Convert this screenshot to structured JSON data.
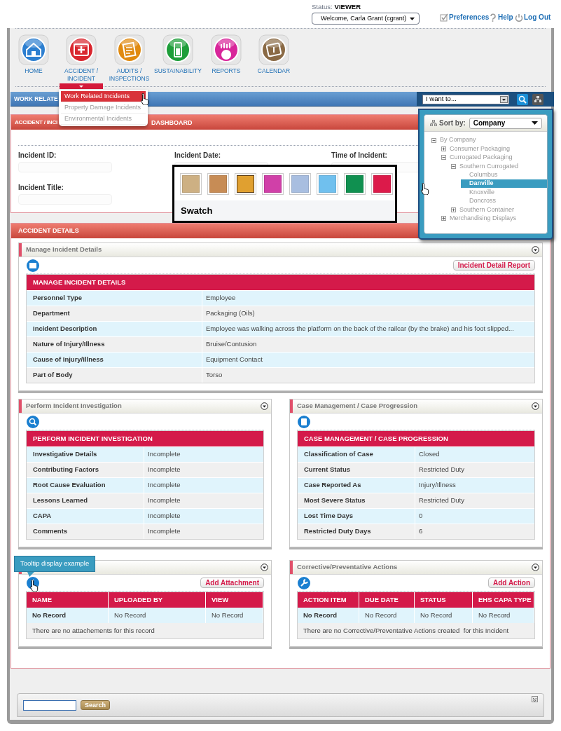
{
  "header": {
    "status_label": "Status:",
    "status_value": "VIEWER",
    "user_select": "Welcome, Carla Grant (cgrant)",
    "links": [
      "Preferences",
      "Help",
      "Log Out"
    ]
  },
  "nav": [
    {
      "label": "HOME",
      "color": "#2d7fd0",
      "selected": false
    },
    {
      "label": "ACCIDENT / INCIDENT",
      "color": "#d9262e",
      "selected": true
    },
    {
      "label": "AUDITS / INSPECTIONS",
      "color": "#e08a10",
      "selected": false
    },
    {
      "label": "SUSTAINABILITY",
      "color": "#1e9e3a",
      "selected": false
    },
    {
      "label": "REPORTS",
      "color": "#d8259a",
      "selected": false
    },
    {
      "label": "CALENDAR",
      "color": "#8a6a45",
      "selected": false
    }
  ],
  "menu": [
    {
      "label": "Work Related Incidents",
      "selected": true
    },
    {
      "label": "Property Damage Incidents",
      "selected": false
    },
    {
      "label": "Environmental Incidents",
      "selected": false
    }
  ],
  "bar": {
    "title": "WORK RELATE",
    "action_select": "I want to..."
  },
  "tree_popup": {
    "sort_label": "Sort by:",
    "sort_value": "Company",
    "tree": [
      {
        "label": "By Company",
        "expanded": true,
        "selected": false,
        "children": [
          {
            "label": "Consumer Packaging",
            "expanded": false,
            "selected": false
          },
          {
            "label": "Currogated Packaging",
            "expanded": true,
            "selected": false,
            "children": [
              {
                "label": "Southern Currogated",
                "expanded": true,
                "selected": false,
                "children": [
                  {
                    "label": "Columbus",
                    "selected": false
                  },
                  {
                    "label": "Danville",
                    "selected": true
                  },
                  {
                    "label": "Knoxville",
                    "selected": false
                  },
                  {
                    "label": "Doncross",
                    "selected": false
                  }
                ]
              },
              {
                "label": "Southern Container",
                "expanded": false,
                "selected": false
              }
            ]
          },
          {
            "label": "Merchandising Displays",
            "expanded": false,
            "selected": false
          }
        ]
      }
    ]
  },
  "dashboard_bar": {
    "title_left": "ACCIDENT / INCI",
    "title_right": "DASHBOARD"
  },
  "form": {
    "fields": [
      "Incident ID:",
      "Incident Date:",
      "Time of Incident:",
      "Incident Title:"
    ]
  },
  "swatch": {
    "title": "Swatch",
    "colors": [
      {
        "color": "#cdb083",
        "selected": false
      },
      {
        "color": "#c78c55",
        "selected": false
      },
      {
        "color": "#e0a030",
        "selected": true
      },
      {
        "color": "#d040a8",
        "selected": false
      },
      {
        "color": "#a8bee0",
        "selected": false
      },
      {
        "color": "#70c0ee",
        "selected": false
      },
      {
        "color": "#109050",
        "selected": false
      },
      {
        "color": "#dc1a4a",
        "selected": false
      }
    ]
  },
  "section_bar": "ACCIDENT DETAILS",
  "panels": [
    {
      "kind": "details",
      "title": "Manage Incident Details",
      "button": "Incident Detail Report",
      "table_title": "MANAGE INCIDENT DETAILS",
      "rows": [
        {
          "label": "Personnel Type",
          "value": "Employee"
        },
        {
          "label": "Department",
          "value": "Packaging (Oils)"
        },
        {
          "label": "Incident Description",
          "value": "Employee was walking across the platform on the back of the railcar (by the brake) and his foot slipped..."
        },
        {
          "label": "Nature of Injury/Illness",
          "value": "Bruise/Contusion"
        },
        {
          "label": "Cause of Injury/Illness",
          "value": "Equipment Contact"
        },
        {
          "label": "Part of Body",
          "value": "Torso"
        }
      ]
    },
    {
      "kind": "details",
      "title": "Perform Incident Investigation",
      "table_title": "PERFORM INCIDENT INVESTIGATION",
      "rows": [
        {
          "label": "Investigative Details",
          "value": "Incomplete"
        },
        {
          "label": "Contributing Factors",
          "value": "Incomplete"
        },
        {
          "label": "Root Cause Evaluation",
          "value": "Incomplete"
        },
        {
          "label": "Lessons Learned",
          "value": "Incomplete"
        },
        {
          "label": "CAPA",
          "value": "Incomplete"
        },
        {
          "label": "Comments",
          "value": "Incomplete"
        }
      ]
    },
    {
      "kind": "details",
      "title": "Case Management / Case Progression",
      "table_title": "CASE MANAGEMENT / CASE PROGRESSION",
      "rows": [
        {
          "label": "Classification of Case",
          "value": "Closed"
        },
        {
          "label": "Current Status",
          "value": "Restricted Duty"
        },
        {
          "label": "Case Reported As",
          "value": "Injury/Illness"
        },
        {
          "label": "Most Severe Status",
          "value": "Restricted Duty"
        },
        {
          "label": "Lost Time Days",
          "value": "0"
        },
        {
          "label": "Restricted Duty Days",
          "value": "6"
        }
      ]
    },
    {
      "kind": "list",
      "button": "Add Attachment",
      "columns": [
        "NAME",
        "UPLOADED BY",
        "VIEW"
      ],
      "rows": [
        [
          "No Record",
          "No Record",
          "No Record"
        ]
      ],
      "message": "There are no attachements for this record"
    },
    {
      "kind": "list",
      "title": "Corrective/Preventative Actions",
      "button": "Add Action",
      "columns": [
        "ACTION ITEM",
        "DUE DATE",
        "STATUS",
        "EHS CAPA TYPE"
      ],
      "rows": [
        [
          "No Record",
          "No Record",
          "No Record",
          "No Record"
        ]
      ],
      "message": "There are no Corrective/Preventative Actions created  for this Incident"
    }
  ],
  "tooltip": "Tooltip display example",
  "footer": {
    "search_button": "Search"
  }
}
